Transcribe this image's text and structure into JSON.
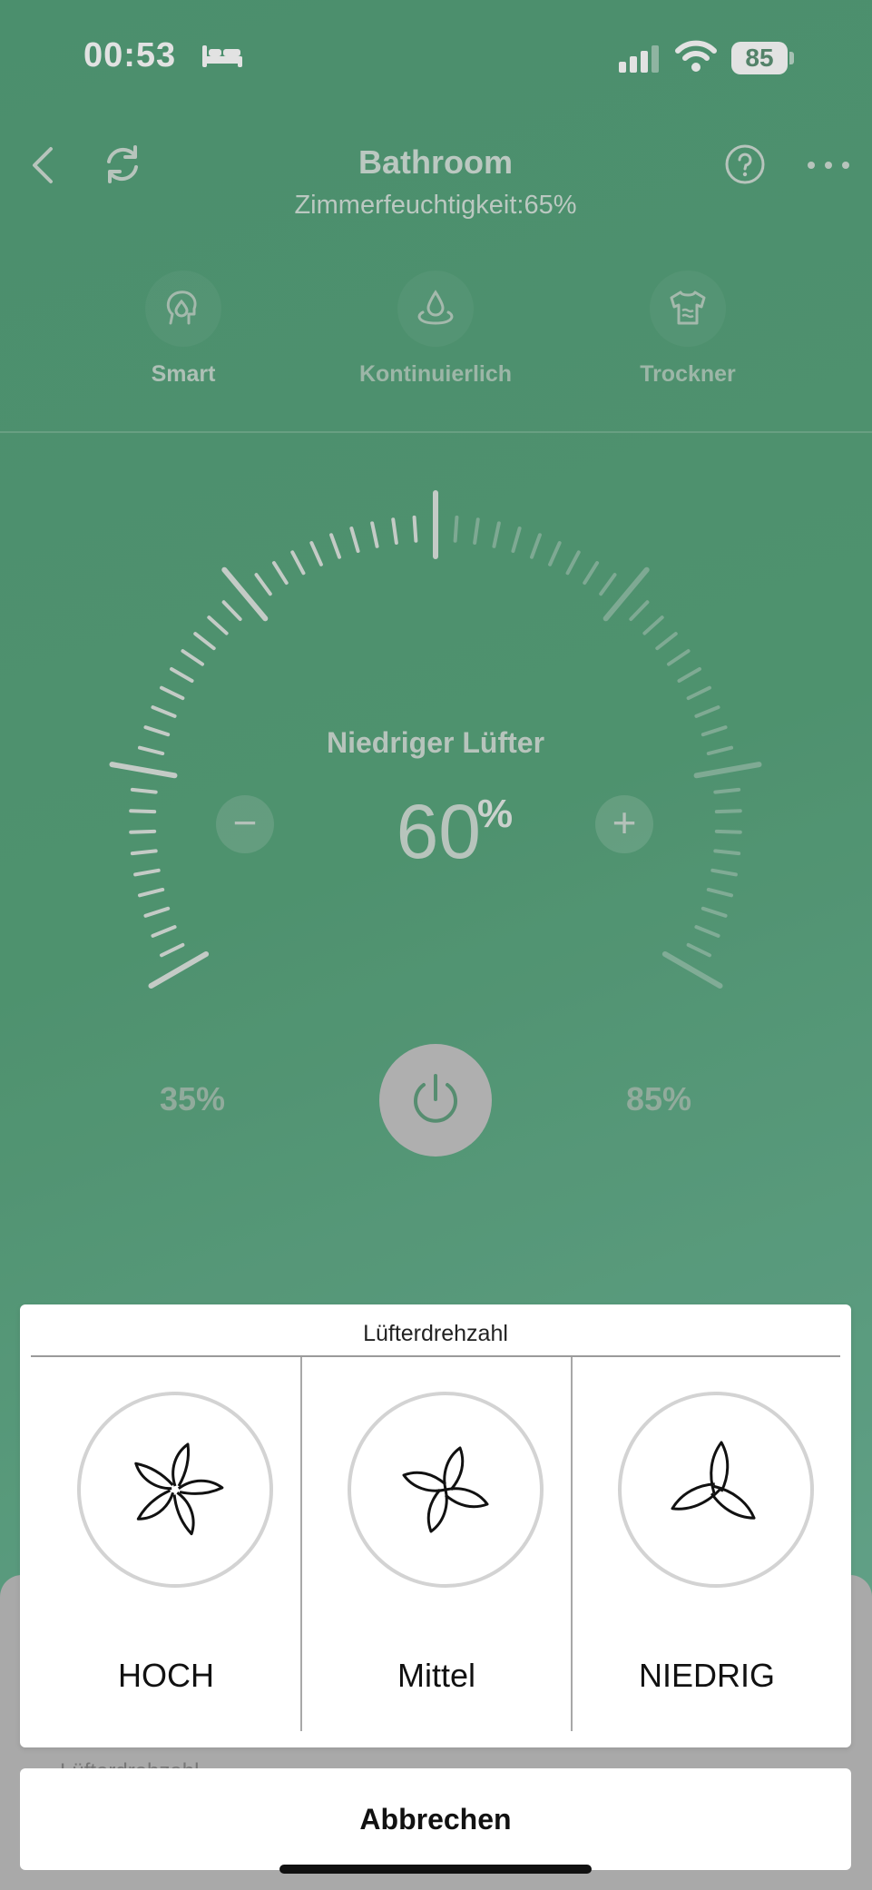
{
  "status_bar": {
    "time": "00:53",
    "battery": "85"
  },
  "header": {
    "title": "Bathroom",
    "subtitle": "Zimmerfeuchtigkeit:65%"
  },
  "modes": [
    {
      "label": "Smart",
      "icon": "head-drop-icon"
    },
    {
      "label": "Kontinuierlich",
      "icon": "water-drop-icon"
    },
    {
      "label": "Trockner",
      "icon": "shirt-icon"
    }
  ],
  "dial": {
    "fan_label": "Niedriger Lüfter",
    "value": "60",
    "unit": "%",
    "minus": "−",
    "plus": "+",
    "min_label": "35%",
    "max_label": "85%"
  },
  "sheet": {
    "title": "Lüfterdrehzahl",
    "options": [
      {
        "label": "HOCH",
        "icon": "fan-five-blade-icon"
      },
      {
        "label": "Mittel",
        "icon": "fan-four-blade-icon"
      },
      {
        "label": "NIEDRIG",
        "icon": "fan-three-blade-icon"
      }
    ],
    "cancel_label": "Abbrechen"
  },
  "background_sheet": {
    "peek_text": "Lüfterdrehzahl"
  },
  "colors": {
    "accent_green": "#2f8c5e",
    "sheet_bg": "#ffffff"
  }
}
